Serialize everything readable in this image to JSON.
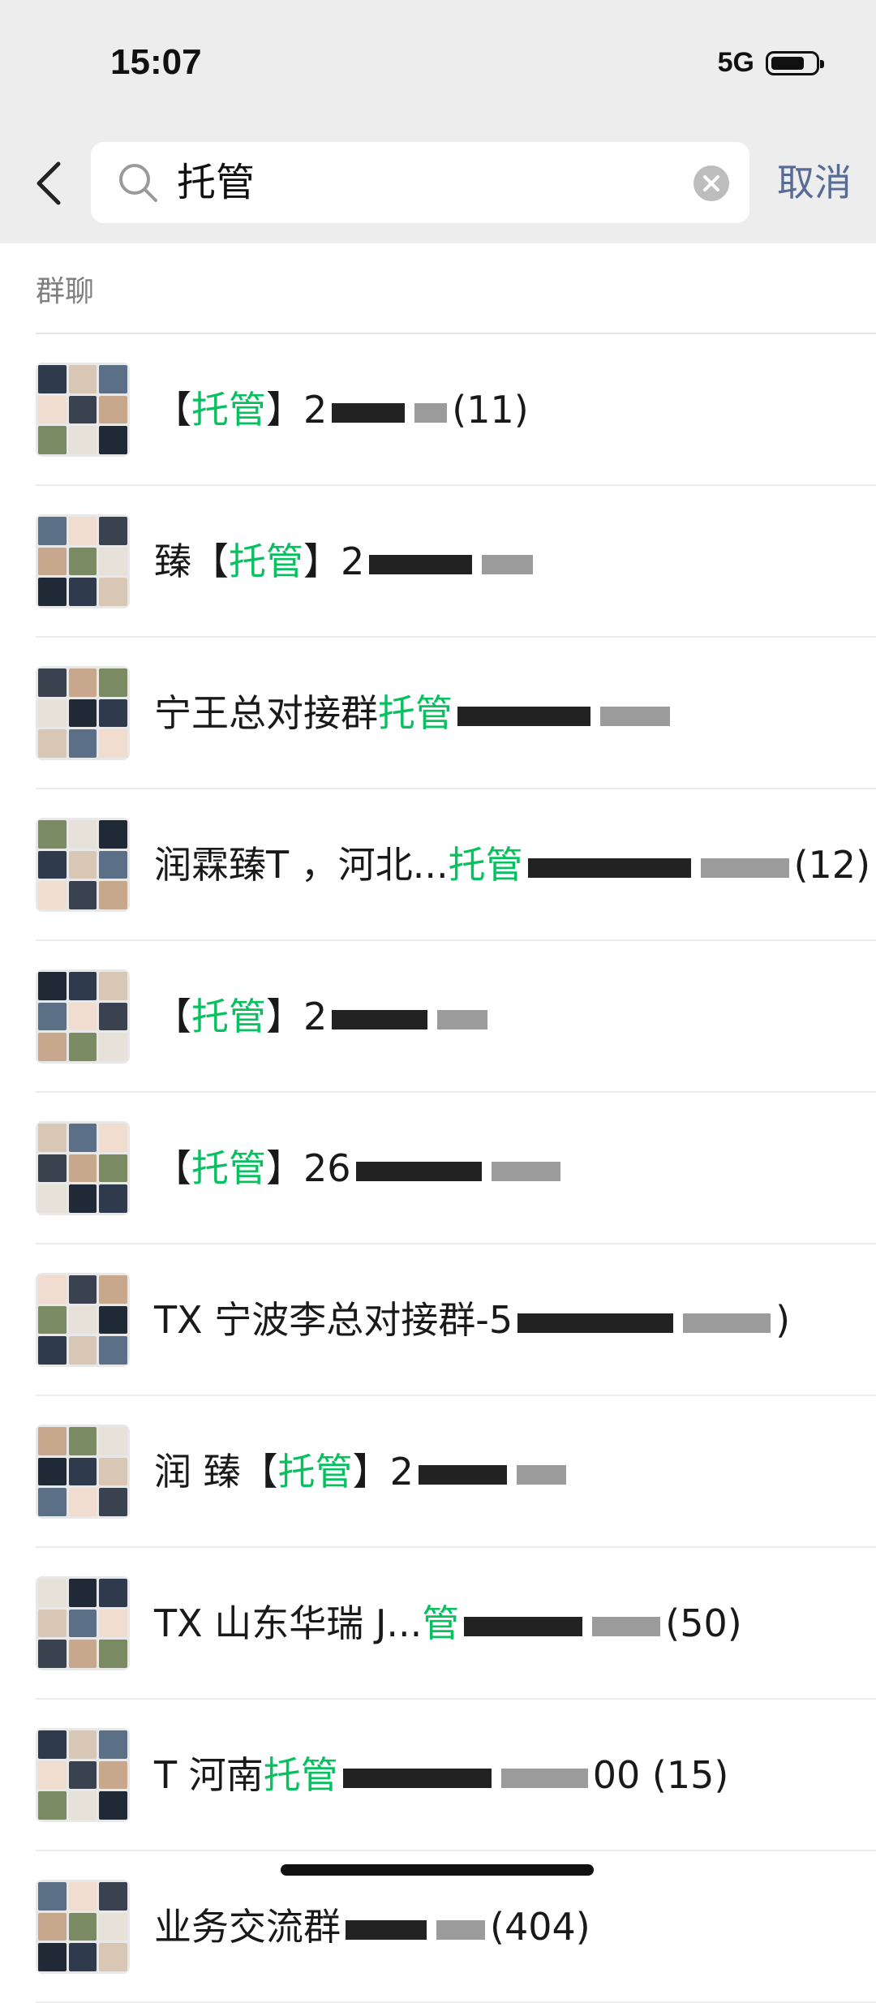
{
  "status_bar": {
    "time": "15:07",
    "network": "5G"
  },
  "search": {
    "query": "托管",
    "cancel_label": "取消"
  },
  "section_header": "群聊",
  "results": [
    {
      "prefix": "【",
      "highlight": "托管",
      "suffix": "】2",
      "tail": "(11)"
    },
    {
      "prefix": "臻【",
      "highlight": "托管",
      "suffix": "】2",
      "tail": ""
    },
    {
      "prefix": "宁王总对接群",
      "highlight": "托管",
      "suffix": "",
      "tail": ""
    },
    {
      "prefix": "润霖臻T ，河北...",
      "highlight": "托管",
      "suffix": "",
      "tail": "(12)"
    },
    {
      "prefix": "【",
      "highlight": "托管",
      "suffix": "】2",
      "tail": ""
    },
    {
      "prefix": "【",
      "highlight": "托管",
      "suffix": "】26",
      "tail": ""
    },
    {
      "prefix": "TX 宁波李总对接群-5",
      "highlight": "",
      "suffix": "",
      "tail": ")"
    },
    {
      "prefix": "润 臻【",
      "highlight": "托管",
      "suffix": "】2",
      "tail": ""
    },
    {
      "prefix": "TX 山东华瑞 J...",
      "highlight": "管",
      "suffix": "",
      "tail": "(50)"
    },
    {
      "prefix": "T 河南",
      "highlight": "托管",
      "suffix": "",
      "tail": "00 (15)"
    },
    {
      "prefix": "业务交流群",
      "highlight": "",
      "suffix": "",
      "tail": "(404)"
    }
  ],
  "colors": {
    "highlight": "#07c160",
    "cancel": "#576b95",
    "header_bg": "#ededed"
  }
}
